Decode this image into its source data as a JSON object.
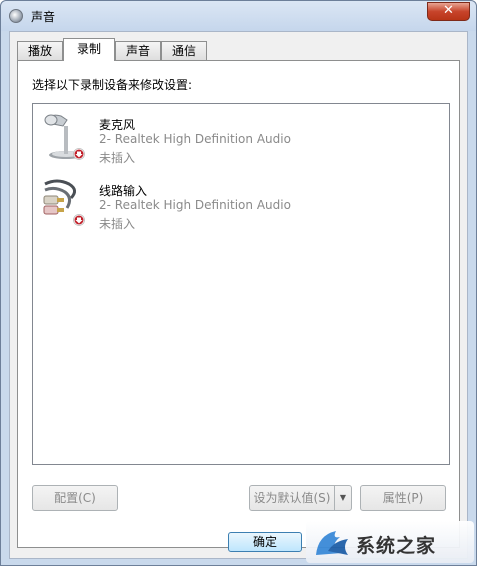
{
  "window": {
    "title": "声音",
    "close_label": "✕"
  },
  "tabs": [
    {
      "label": "播放",
      "active": false
    },
    {
      "label": "录制",
      "active": true
    },
    {
      "label": "声音",
      "active": false
    },
    {
      "label": "通信",
      "active": false
    }
  ],
  "panel": {
    "instruction": "选择以下录制设备来修改设置:"
  },
  "devices": [
    {
      "name": "麦克风",
      "description": "2- Realtek High Definition Audio",
      "status": "未插入",
      "icon": "microphone-icon"
    },
    {
      "name": "线路输入",
      "description": "2- Realtek High Definition Audio",
      "status": "未插入",
      "icon": "line-in-cable-icon"
    }
  ],
  "buttons": {
    "configure": "配置(C)",
    "set_default": "设为默认值(S)",
    "properties": "属性(P)",
    "ok": "确定"
  },
  "watermark": {
    "text": "系统之家"
  },
  "colors": {
    "title_bar": "#c9d9ec",
    "close_button": "#c7442b",
    "disabled_text": "#8a8a8a",
    "status_arrow": "#c0202a"
  }
}
